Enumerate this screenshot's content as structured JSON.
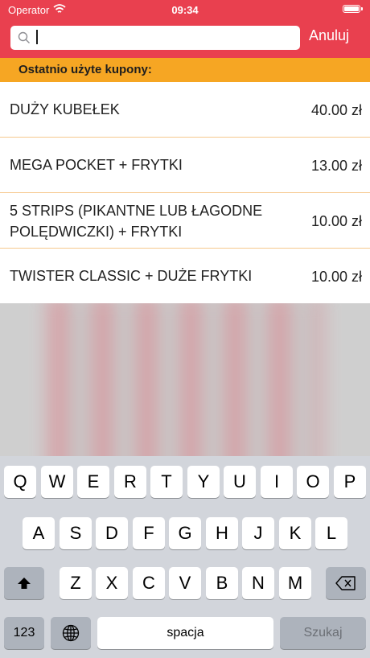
{
  "status": {
    "carrier": "Operator",
    "time": "09:34"
  },
  "search": {
    "placeholder": "",
    "cancel_label": "Anuluj"
  },
  "section": {
    "title": "Ostatnio użyte kupony:"
  },
  "items": [
    {
      "name": "DUŻY KUBEŁEK",
      "price": "40.00 zł"
    },
    {
      "name": "MEGA POCKET + FRYTKI",
      "price": "13.00 zł"
    },
    {
      "name": "5 STRIPS (PIKANTNE LUB ŁAGODNE POLĘDWICZKI) + FRYTKI",
      "price": "10.00 zł"
    },
    {
      "name": "TWISTER CLASSIC + DUŻE FRYTKI",
      "price": "10.00 zł"
    }
  ],
  "keyboard": {
    "row1": [
      "Q",
      "W",
      "E",
      "R",
      "T",
      "Y",
      "U",
      "I",
      "O",
      "P"
    ],
    "row2": [
      "A",
      "S",
      "D",
      "F",
      "G",
      "H",
      "J",
      "K",
      "L"
    ],
    "row3": [
      "Z",
      "X",
      "C",
      "V",
      "B",
      "N",
      "M"
    ],
    "numbers_label": "123",
    "space_label": "spacja",
    "search_label": "Szukaj"
  },
  "colors": {
    "header": "#e9404f",
    "section": "#f6a623"
  }
}
